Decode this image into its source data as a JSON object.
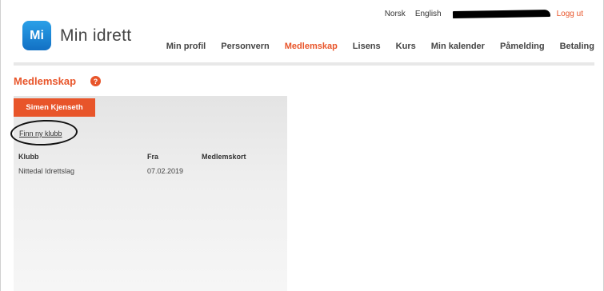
{
  "topbar": {
    "lang_no": "Norsk",
    "lang_en": "English",
    "logout": "Logg ut"
  },
  "logo": {
    "badge": "Mi",
    "text": "Min idrett"
  },
  "nav": {
    "items": [
      "Min profil",
      "Personvern",
      "Medlemskap",
      "Lisens",
      "Kurs",
      "Min kalender",
      "Påmelding",
      "Betaling"
    ],
    "active": "Medlemskap"
  },
  "page": {
    "title": "Medlemskap",
    "help": "?"
  },
  "panel": {
    "person_tab": "Simen Kjenseth",
    "find_link": "Finn ny klubb",
    "headers": {
      "club": "Klubb",
      "from": "Fra",
      "card": "Medlemskort"
    },
    "rows": [
      {
        "club": "Nittedal Idrettslag",
        "from": "07.02.2019",
        "card": ""
      }
    ]
  },
  "colors": {
    "accent": "#e8552a",
    "logo_blue": "#1d86d6"
  }
}
